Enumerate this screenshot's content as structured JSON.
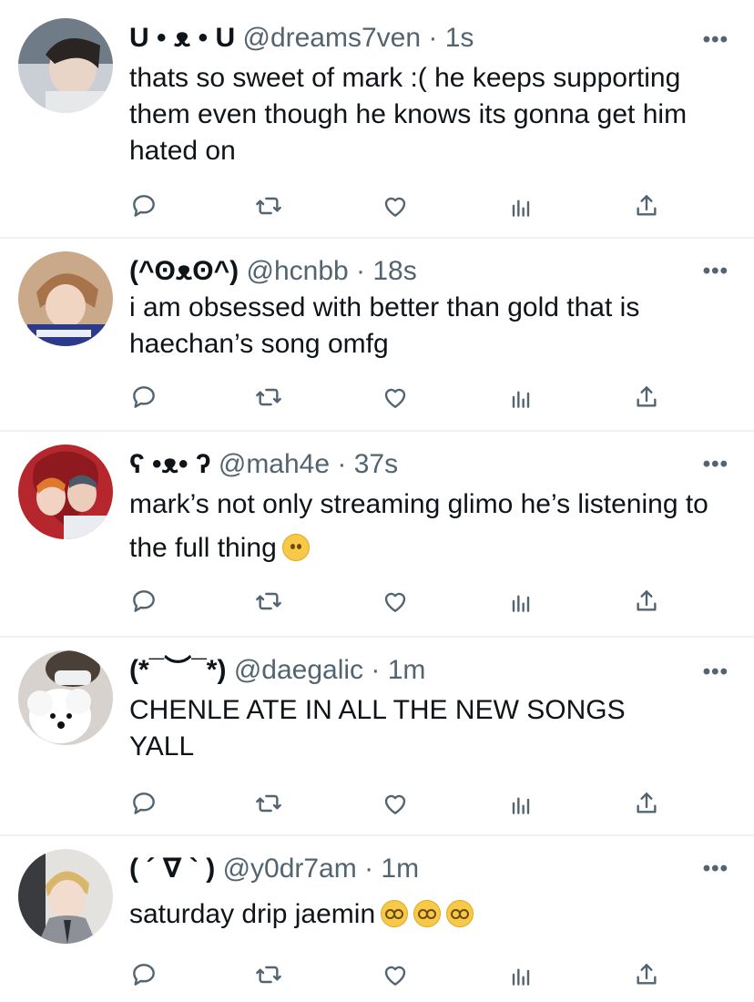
{
  "tweets": [
    {
      "name": "U • ᴥ • U",
      "handle": "@dreams7ven",
      "time": "· 1s",
      "text": "thats so sweet of mark :( he keeps supporting them even though he knows its gonna get him hated on",
      "emojis": []
    },
    {
      "name": "(^ʘᴥʘ^)",
      "handle": "@hcnbb",
      "time": "· 18s",
      "text": "i am obsessed with better than gold that is haechan’s song omfg",
      "emojis": []
    },
    {
      "name": "ʕ •ᴥ• ʔ",
      "handle": "@mah4e",
      "time": "· 37s",
      "text": "mark’s not only streaming glimo he’s listening to the full thing",
      "emojis": [
        "slightly-frowning-face"
      ]
    },
    {
      "name": "(*¯︶¯*)",
      "handle": "@daegalic",
      "time": "· 1m",
      "text": "CHENLE ATE IN ALL THE NEW SONGS YALL",
      "emojis": []
    },
    {
      "name": "( ´ ∇ ` )",
      "handle": "@y0dr7am",
      "time": "· 1m",
      "text": "saturday drip jaemin",
      "emojis": [
        "dizzy-face",
        "dizzy-face",
        "dizzy-face"
      ]
    }
  ],
  "ui": {
    "more_label": "•••",
    "colors": {
      "icon": "#536471",
      "text": "#0f1419",
      "divider": "#eff3f4"
    },
    "action_icons": [
      "reply-icon",
      "retweet-icon",
      "like-icon",
      "analytics-icon",
      "share-icon"
    ]
  }
}
